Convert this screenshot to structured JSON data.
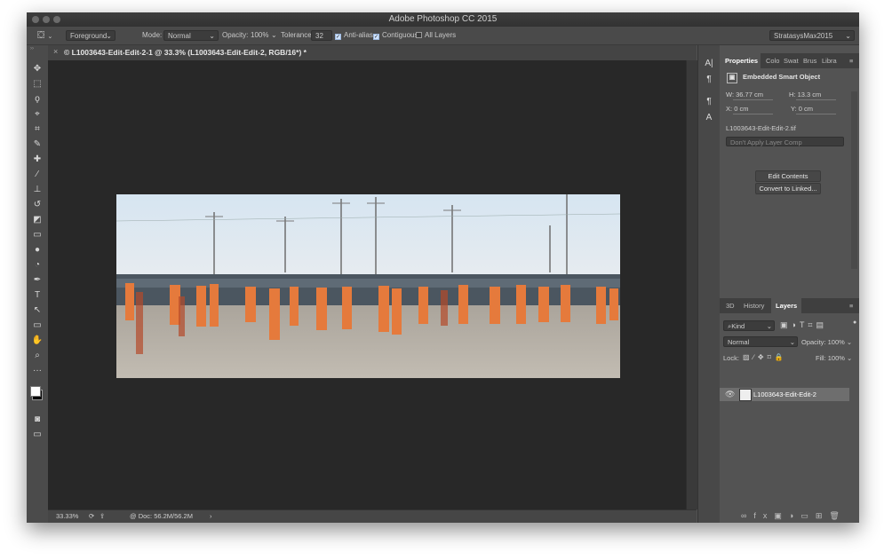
{
  "window": {
    "title": "Adobe Photoshop CC 2015"
  },
  "options": {
    "tool_preset_icon": "paint-bucket-icon",
    "fill_source": "Foreground",
    "mode_label": "Mode:",
    "mode_value": "Normal",
    "opacity_label": "Opacity:",
    "opacity_value": "100%",
    "tolerance_label": "Tolerance:",
    "tolerance_value": "32",
    "anti_alias_label": "Anti-alias",
    "contiguous_label": "Contiguous",
    "all_layers_label": "All Layers",
    "workspace": "StratasysMax2015"
  },
  "document": {
    "tab_title": "© L1003643-Edit-Edit-2-1 @ 33.3% (L1003643-Edit-Edit-2, RGB/16*) *",
    "image_description_icon": "photo-crowd"
  },
  "status": {
    "zoom": "33.33%",
    "doc_info": "@ Doc: 56.2M/56.2M",
    "arrow": "›"
  },
  "tools": [
    {
      "name": "move-tool-icon",
      "glyph": "✥"
    },
    {
      "name": "marquee-tool-icon",
      "glyph": "⬚"
    },
    {
      "name": "lasso-tool-icon",
      "glyph": "ϙ"
    },
    {
      "name": "quick-select-tool-icon",
      "glyph": "⌖"
    },
    {
      "name": "crop-tool-icon",
      "glyph": "⌗"
    },
    {
      "name": "eyedropper-tool-icon",
      "glyph": "✎"
    },
    {
      "name": "healing-brush-tool-icon",
      "glyph": "✚"
    },
    {
      "name": "brush-tool-icon",
      "glyph": "∕"
    },
    {
      "name": "stamp-tool-icon",
      "glyph": "⊥"
    },
    {
      "name": "history-brush-tool-icon",
      "glyph": "↺"
    },
    {
      "name": "eraser-tool-icon",
      "glyph": "◩"
    },
    {
      "name": "gradient-tool-icon",
      "glyph": "▭"
    },
    {
      "name": "blur-tool-icon",
      "glyph": "●"
    },
    {
      "name": "dodge-tool-icon",
      "glyph": "◔"
    },
    {
      "name": "pen-tool-icon",
      "glyph": "✒"
    },
    {
      "name": "type-tool-icon",
      "glyph": "T"
    },
    {
      "name": "path-select-tool-icon",
      "glyph": "↖"
    },
    {
      "name": "shape-tool-icon",
      "glyph": "▭"
    },
    {
      "name": "hand-tool-icon",
      "glyph": "✋"
    },
    {
      "name": "zoom-tool-icon",
      "glyph": "⌕"
    },
    {
      "name": "more-tools-icon",
      "glyph": "···"
    }
  ],
  "properties": {
    "tabs": [
      "Properties",
      "Colo",
      "Swat",
      "Brus",
      "Libra"
    ],
    "header": "Embedded Smart Object",
    "w_label": "W:",
    "w_value": "36.77 cm",
    "h_label": "H:",
    "h_value": "13.3 cm",
    "x_label": "X:",
    "x_value": "0 cm",
    "y_label": "Y:",
    "y_value": "0 cm",
    "filename": "L1003643-Edit-Edit-2.tif",
    "layer_comp": "Don't Apply Layer Comp",
    "edit_contents": "Edit Contents",
    "convert_linked": "Convert to Linked..."
  },
  "layers": {
    "tabs": [
      "3D",
      "History",
      "Layers"
    ],
    "kind": "Kind",
    "blend_mode": "Normal",
    "opacity_label": "Opacity:",
    "opacity_value": "100%",
    "lock_label": "Lock:",
    "fill_label": "Fill:",
    "fill_value": "100%",
    "layer_name": "L1003643-Edit-Edit-2"
  },
  "colors": {
    "window_bg": "#535353",
    "canvas_bg": "#282828",
    "sky": "#cfe0ee",
    "ground": "#b9b2a6",
    "robe": "#e57a3c"
  }
}
